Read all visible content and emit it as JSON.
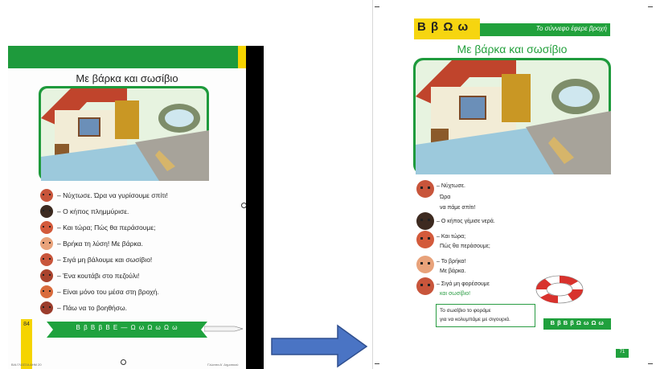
{
  "colors": {
    "page_green": "#21a13c",
    "page_yellow": "#f6d510",
    "arrow_blue": "#4a74c4",
    "ring_red": "#d8322d"
  },
  "left_page": {
    "title": "Με βάρκα και σωσίβιο",
    "dialogue": [
      {
        "text": "– Νύχτωσε. Ώρα να γυρίσουμε σπίτι!",
        "face": "#c8553b"
      },
      {
        "text": "– Ο κήπος πλημμύρισε.",
        "face": "#3d2a20"
      },
      {
        "text": "– Και τώρα; Πώς θα περάσουμε;",
        "face": "#d35a3b"
      },
      {
        "text": "– Βρήκα τη λύση! Με βάρκα.",
        "face": "#e8a27a"
      },
      {
        "text": "– Σιγά μη βάλουμε και σωσίβιο!",
        "face": "#c8553b"
      },
      {
        "text": "– Ένα κουτάβι στο πεζούλι!",
        "face": "#a9432e"
      },
      {
        "text": "– Είναι μόνο του μέσα στη βροχή.",
        "face": "#d96b3c"
      },
      {
        "text": "– Πάω να το βοηθήσω.",
        "face": "#9b3c2c"
      }
    ],
    "banner": "Β β   Β β   Β Ε   —   Ω ω   Ω ω   Ω ω",
    "page_number": "84",
    "footer_left": "Β/Α ΓΛΩΣΣΑ ΔΗΜ 20",
    "footer_right": "Γλώσσα Α΄ Δημοτικού"
  },
  "right_page": {
    "letters": "Β β  Ω ω",
    "bar_text": "Το σύννεφο έφερε βροχή",
    "title": "Με βάρκα και σωσίβιο",
    "dialogue": [
      {
        "face": "#c8553b",
        "lines": [
          "– Νύχτωσε.",
          "Ώρα",
          "να πάμε σπίτι!"
        ]
      },
      {
        "face": "#3d2a20",
        "lines": [
          "– Ο κήπος γέμισε νερά."
        ]
      },
      {
        "face": "#d35a3b",
        "lines": [
          "– Και τώρα;",
          "Πώς θα περάσουμε;"
        ]
      },
      {
        "face": "#e8a27a",
        "lines": [
          "– Το βρήκα!",
          "Με βάρκα."
        ]
      },
      {
        "face": "#c8553b",
        "lines": [
          "– Σιγά μη φορέσουμε",
          "και σωσίβιο!"
        ]
      }
    ],
    "highlight_word": "σωσίβιο",
    "info_box": [
      "Το σωσίβιο το φοράμε",
      "για να κολυμπάμε με σιγουριά."
    ],
    "banner": "Β β  Β β  Ω ω  Ω ω",
    "page_number": "71"
  }
}
